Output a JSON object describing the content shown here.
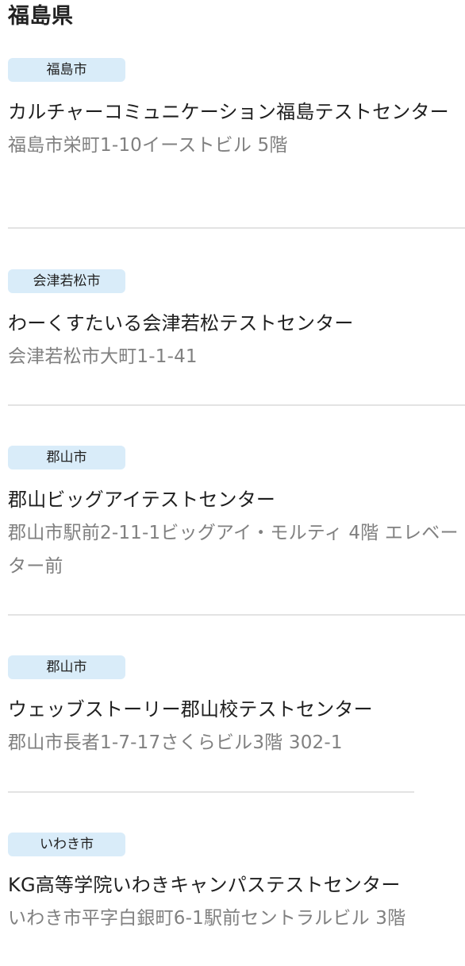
{
  "prefecture": {
    "title": "福島県"
  },
  "centers": [
    {
      "city": "福島市",
      "name": "カルチャーコミュニケーション福島テストセンター",
      "address": "福島市栄町1-10イーストビル 5階"
    },
    {
      "city": "会津若松市",
      "name": "わーくすたいる会津若松テストセンター",
      "address": "会津若松市大町1-1-41"
    },
    {
      "city": "郡山市",
      "name": "郡山ビッグアイテストセンター",
      "address": "郡山市駅前2-11-1ビッグアイ・モルティ 4階 エレベーター前"
    },
    {
      "city": "郡山市",
      "name": "ウェッブストーリー郡山校テストセンター",
      "address": "郡山市長者1-7-17さくらビル3階 302-1"
    },
    {
      "city": "いわき市",
      "name": "KG高等学院いわきキャンパステストセンター",
      "address": "いわき市平字白銀町6-1駅前セントラルビル 3階"
    }
  ]
}
